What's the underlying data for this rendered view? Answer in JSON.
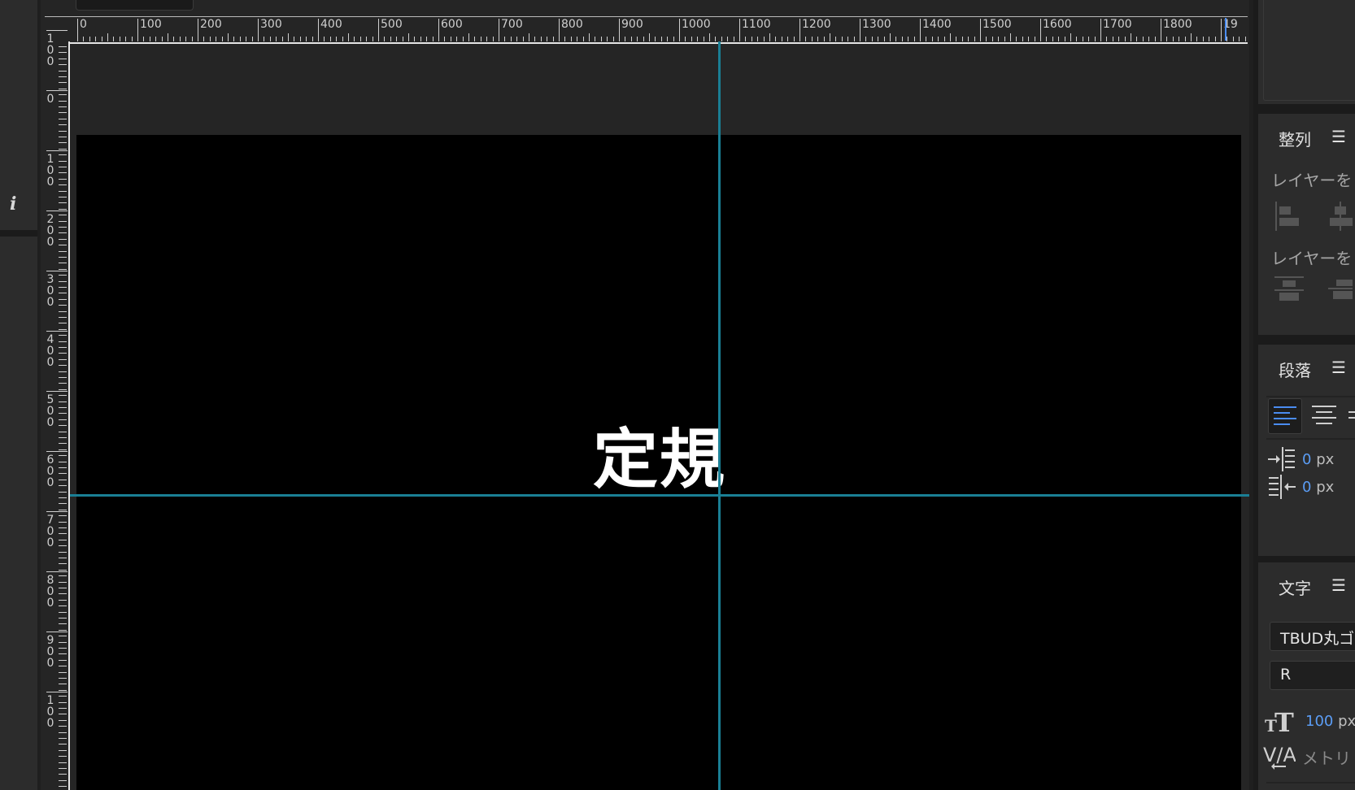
{
  "top_tab": {
    "label": ""
  },
  "ruler": {
    "horizontal_labels": [
      "0",
      "100",
      "200",
      "300",
      "400",
      "500",
      "600",
      "700",
      "800",
      "900",
      "1000",
      "1100",
      "1200",
      "1300",
      "1400",
      "1500",
      "1600",
      "1700",
      "1800",
      "19"
    ],
    "vertical_labels": [
      "1\n0\n0",
      "0",
      "1\n0\n0",
      "2\n0\n0",
      "3\n0\n0",
      "4\n0\n0",
      "5\n0\n0",
      "6\n0\n0",
      "7\n0\n0",
      "8\n0\n0",
      "9\n0\n0",
      "1\n0\n0"
    ]
  },
  "canvas": {
    "text": "定規",
    "background": "#000000",
    "guide_color": "#1a7f95"
  },
  "left_strip": {
    "info_icon": "i"
  },
  "panels": {
    "align": {
      "title": "整列",
      "menu": "☰",
      "label_1": "レイヤーを",
      "label_2": "レイヤーを"
    },
    "paragraph": {
      "title": "段落",
      "menu": "☰",
      "indent_left_value": "0",
      "indent_right_value": "0",
      "unit": "px"
    },
    "character": {
      "title": "文字",
      "menu": "☰",
      "font_family": "TBUD丸ゴ",
      "font_style": "R",
      "font_size_value": "100",
      "font_size_unit": "px",
      "tracking_placeholder": "メトリ"
    }
  },
  "colors": {
    "accent": "#5b9df5",
    "panel": "#2c2c2c",
    "background": "#1f1f1f"
  }
}
